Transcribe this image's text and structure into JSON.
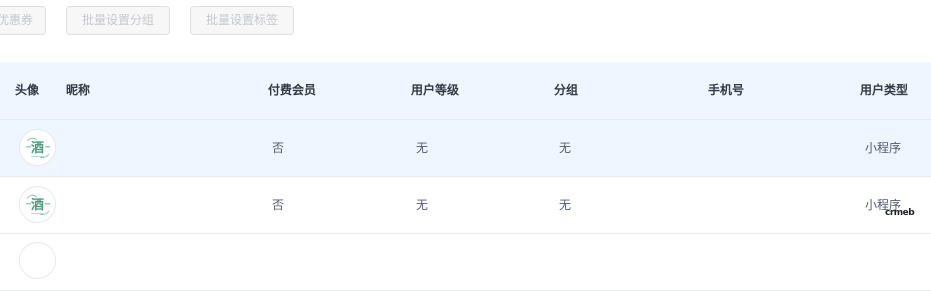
{
  "toolbar": {
    "coupon_label": "优惠券",
    "batch_group_label": "批量设置分组",
    "batch_tag_label": "批量设置标签"
  },
  "table": {
    "headers": {
      "avatar": "头像",
      "nickname": "昵称",
      "paid_member": "付费会员",
      "user_level": "用户等级",
      "group": "分组",
      "phone": "手机号",
      "user_type": "用户类型"
    },
    "rows": [
      {
        "avatar": "wine-logo-icon",
        "avatar_text": "酒",
        "nickname": "",
        "paid_member": "否",
        "user_level": "无",
        "group": "无",
        "phone": "",
        "user_type": "小程序"
      },
      {
        "avatar": "wine-logo-icon",
        "avatar_text": "酒",
        "nickname": "",
        "paid_member": "否",
        "user_level": "无",
        "group": "无",
        "phone": "",
        "user_type": "小程序"
      }
    ]
  },
  "watermark": "crmeb",
  "colors": {
    "header_bg": "#f0f6ff",
    "row_highlight": "#f0f6ff",
    "border": "#e8eaec",
    "avatar_green": "#5aa88a"
  }
}
